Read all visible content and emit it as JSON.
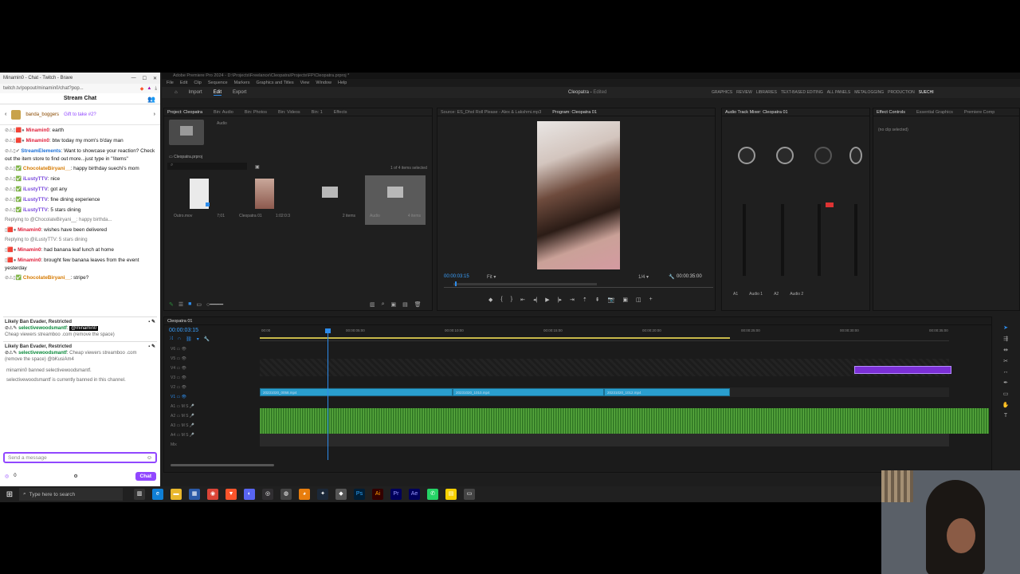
{
  "chat_window": {
    "title": "Minamin0 - Chat - Twitch - Brave",
    "url": "twitch.tv/popout/minamin0/chat?pop...",
    "header": "Stream Chat",
    "pinned_user": "banda_boggers",
    "pinned_gift": "Gift to take #2?",
    "messages": [
      {
        "user": "Minamin0",
        "color": "red",
        "text": "earth"
      },
      {
        "user": "Minamin0",
        "color": "red",
        "text": "btw today my mom's b'day man"
      },
      {
        "user": "StreamElements",
        "color": "blue",
        "text": "Want to showcase your reaction? Check out the item store to find out more...just type in \"!items\""
      },
      {
        "user": "ChocolateBiryani__",
        "color": "orange",
        "text": "happy birthday suechi's mom"
      },
      {
        "user": "iLustyTTV",
        "color": "purple",
        "text": "nice"
      },
      {
        "user": "iLustyTTV",
        "color": "purple",
        "text": "got any"
      },
      {
        "user": "iLustyTTV",
        "color": "purple",
        "text": "fine dining experience"
      },
      {
        "user": "iLustyTTV",
        "color": "purple",
        "text": "5 stars dining"
      }
    ],
    "reply1": "Replying to @ChocolateBiryani__: happy birthda...",
    "msg_after_reply1": {
      "user": "Minamin0",
      "text": "wishes have been delivered"
    },
    "reply2": "Replying to @iLustyTTV: 5 stars dining",
    "msg_after_reply2a": {
      "user": "Minamin0",
      "text": "had banana leaf lunch at home"
    },
    "msg_after_reply2b": {
      "user": "Minamin0",
      "text": "brought few banana leaves from the event yesterday"
    },
    "msg_last": {
      "user": "ChocolateBiryani__",
      "text": "stripe?"
    },
    "mod1_header": "Likely Ban Evader, Restricted",
    "mod1_user": "selectivewoodsmantf",
    "mod1_mention": "@minamin0",
    "mod1_text": "Cheap viewers streamboo .com (remove the space)",
    "mod2_header": "Likely Ban Evader, Restricted",
    "mod2_user": "selectivewoodsmantf",
    "mod2_text": "Cheap viewers streamboo .com (remove the space) @bKusiAm4",
    "sys1": "minamin0 banned selectivewoodsmantf.",
    "sys2": "selectivewoodsmantf is currently banned in this channel.",
    "input_placeholder": "Send a message",
    "points": "0",
    "chat_button": "Chat"
  },
  "premiere": {
    "title": "Adobe Premiere Pro 2024 - D:\\Projects\\Freelance\\Cleopatra\\Projects\\FP\\Cleopatra.prproj *",
    "menu": [
      "File",
      "Edit",
      "Clip",
      "Sequence",
      "Markers",
      "Graphics and Titles",
      "View",
      "Window",
      "Help"
    ],
    "top_tabs": [
      "Import",
      "Edit",
      "Export"
    ],
    "project_name": "Cleopatra",
    "edited": "Edited",
    "workspaces": [
      "GRAPHICS",
      "REVIEW",
      "LIBRARIES",
      "TEXT-BASED EDITING",
      "ALL PANELS",
      "METALOGGING",
      "PRODUCTION",
      "SUECHI"
    ],
    "project_panel_tabs": [
      "Project: Cleopatra",
      "Bin: Audio",
      "Bin: Photos",
      "Bin: Videos",
      "Bin: 1",
      "Effects"
    ],
    "project_file": "Cleopatra.prproj",
    "items_selected": "1 of 4 items selected",
    "bins": [
      {
        "name": "Outro.mov",
        "dur": "7;01"
      },
      {
        "name": "Cleopatra 01",
        "dur": "1:02:0:3"
      },
      {
        "name": "",
        "dur": "2 items"
      },
      {
        "name": "Audio",
        "dur": "4 items"
      }
    ],
    "audio_bin_label": "Audio",
    "source_tab": "Source: ES_Dhol Roll Please - Alex & Lakshmi.mp3",
    "program_tab": "Program: Cleopatra 01",
    "program_tc": "00:00:03:15",
    "fit": "Fit",
    "quality": "1/4",
    "program_dur": "00:00:35:00",
    "mixer_tab": "Audio Track Mixer: Cleopatra 01",
    "mixer_channels": [
      "A1",
      "Audio 1",
      "A2",
      "Audio 2"
    ],
    "effect_tabs": [
      "Effect Controls",
      "Essential Graphics",
      "Premiere Comp"
    ],
    "effect_empty": "(no clip selected)",
    "seq_tab": "Cleopatra 01",
    "timeline_tc": "00:00:03:15",
    "ruler": [
      "00:00",
      "00:00:05:00",
      "00:00:10:00",
      "00:00:15:00",
      "00:00:20:00",
      "00:00:25:00",
      "00:00:30:00",
      "00:00:35:00"
    ],
    "track_labels": [
      "V6",
      "V5",
      "V4",
      "V3",
      "V2",
      "V1",
      "A1",
      "A2",
      "A3",
      "A4",
      "Mix"
    ],
    "clips": [
      "20231020_0058.mp4",
      "20231020_1010.mp4",
      "20231020_1012.mp4",
      "20231020_1030.mp4"
    ]
  },
  "taskbar": {
    "search_placeholder": "Type here to search"
  }
}
